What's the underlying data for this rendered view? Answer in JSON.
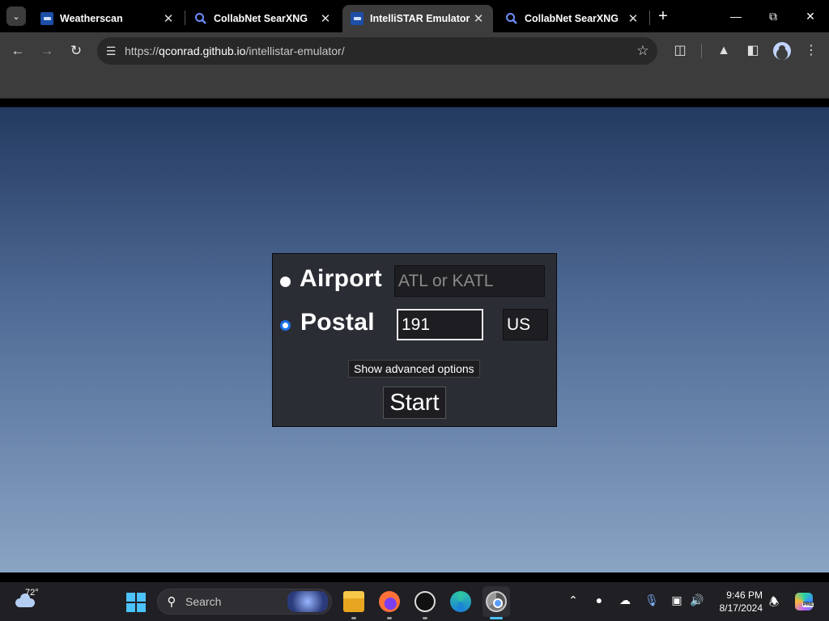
{
  "browser": {
    "tabs": [
      {
        "title": "Weatherscan",
        "active": false,
        "favicon": "weatherscan-icon"
      },
      {
        "title": "CollabNet SearXNG",
        "active": false,
        "favicon": "searxng-icon"
      },
      {
        "title": "IntelliSTAR Emulator",
        "active": true,
        "favicon": "weatherscan-icon"
      },
      {
        "title": "CollabNet SearXNG",
        "active": false,
        "favicon": "searxng-icon"
      }
    ],
    "url_prefix": "https://",
    "url_host": "qconrad.github.io",
    "url_path": "/intellistar-emulator/"
  },
  "form": {
    "airport_label": "Airport",
    "airport_placeholder": "ATL or KATL",
    "airport_value": "",
    "postal_label": "Postal",
    "postal_value": "191",
    "country_value": "US",
    "selected_mode": "postal",
    "advanced_label": "Show advanced options",
    "start_label": "Start"
  },
  "taskbar": {
    "temperature": "72°",
    "search_placeholder": "Search",
    "time": "9:46 PM",
    "date": "8/17/2024",
    "copilot_badge": "PRE",
    "accent_color": "#4cc2ff"
  }
}
